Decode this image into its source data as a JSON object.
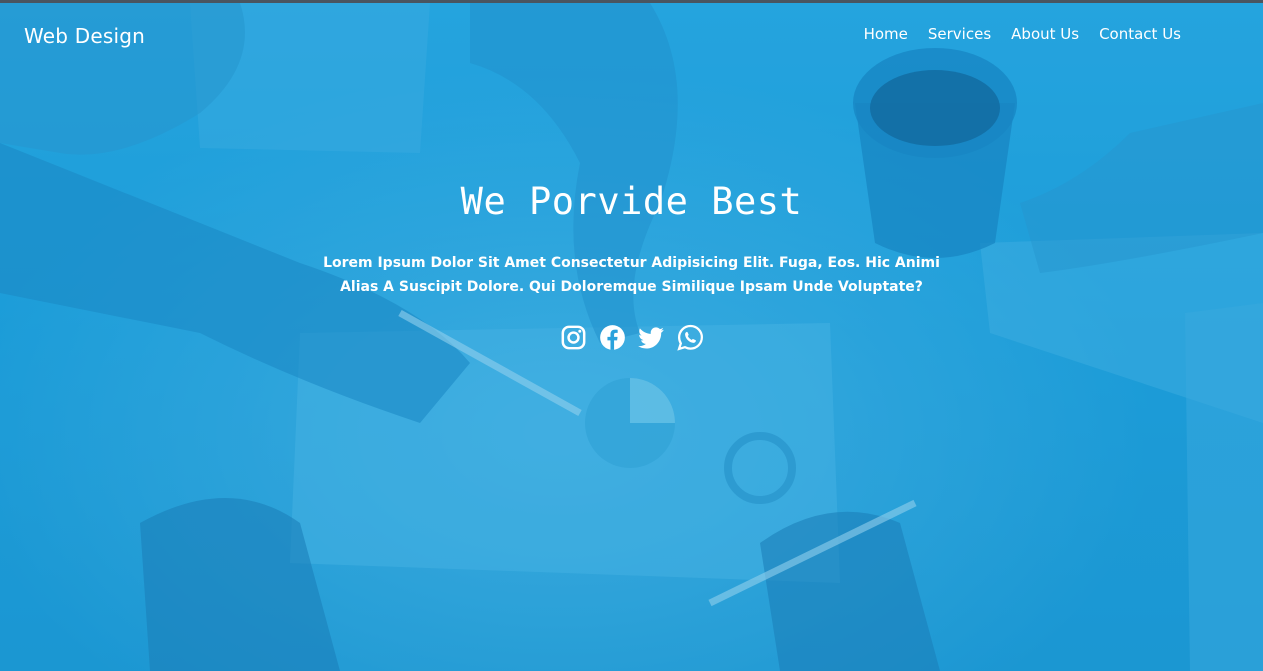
{
  "brand": "Web Design",
  "nav": {
    "items": [
      {
        "label": "Home"
      },
      {
        "label": "Services"
      },
      {
        "label": "About Us"
      },
      {
        "label": "Contact Us"
      }
    ]
  },
  "hero": {
    "title": "We Porvide Best",
    "subtitle": "Lorem Ipsum Dolor Sit Amet Consectetur Adipisicing Elit. Fuga, Eos. Hic Animi Alias A Suscipit Dolore. Qui Doloremque Similique Ipsam Unde Voluptate?"
  },
  "socials": [
    {
      "icon": "instagram-icon"
    },
    {
      "icon": "facebook-icon"
    },
    {
      "icon": "twitter-icon"
    },
    {
      "icon": "whatsapp-icon"
    }
  ],
  "colors": {
    "background": "#1f9fd9",
    "text": "#ffffff",
    "top_border": "#4a5560"
  }
}
